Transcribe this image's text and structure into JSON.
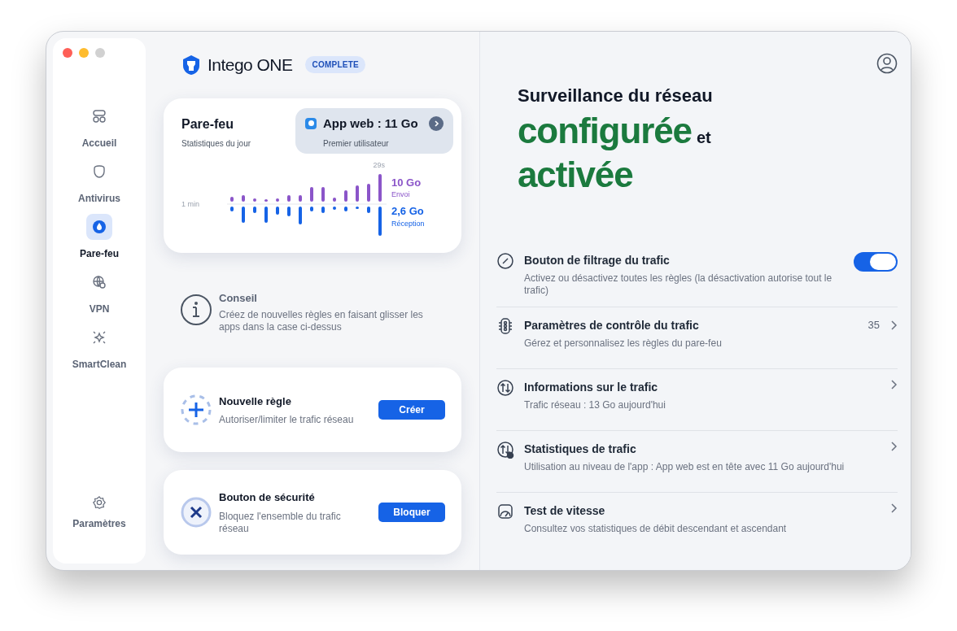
{
  "window": {
    "controls": [
      {
        "kind": "close"
      },
      {
        "kind": "minimize"
      },
      {
        "kind": "zoom"
      }
    ]
  },
  "sidebar": {
    "items": [
      {
        "label": "Accueil",
        "selected": false
      },
      {
        "label": "Antivirus",
        "selected": false
      },
      {
        "label": "Pare-feu",
        "selected": true
      },
      {
        "label": "VPN",
        "selected": false
      },
      {
        "label": "SmartClean",
        "selected": false
      }
    ],
    "footer": {
      "label": "Paramètres"
    }
  },
  "brand": {
    "name": "Intego ONE",
    "badge": "COMPLETE"
  },
  "firewall_card": {
    "title": "Pare-feu",
    "subtitle": "Statistiques du jour",
    "top_app": {
      "title": "App web : 11 Go",
      "subtitle": "Premier utilisateur"
    },
    "chart": {
      "time_start": "1 min",
      "time_end": "29s",
      "sent": {
        "value": "10 Go",
        "label": "Envoi"
      },
      "received": {
        "value": "2,6 Go",
        "label": "Réception"
      }
    }
  },
  "tip": {
    "title": "Conseil",
    "text": "Créez de nouvelles règles en faisant glisser les apps dans la case ci-dessus"
  },
  "action_cards": [
    {
      "title": "Nouvelle règle",
      "text": "Autoriser/limiter le trafic réseau",
      "button": "Créer"
    },
    {
      "title": "Bouton de sécurité",
      "text": "Bloquez l'ensemble du trafic réseau",
      "button": "Bloquer"
    }
  ],
  "headline": {
    "line1": "Surveillance du réseau",
    "parts": [
      {
        "text": "configurée",
        "kind": "highlight"
      },
      {
        "text": "et",
        "kind": "plain"
      },
      {
        "text": "activée",
        "kind": "highlight"
      }
    ]
  },
  "settings": [
    {
      "kind": "toggle",
      "title": "Bouton de filtrage du trafic",
      "text": "Activez ou désactivez toutes les règles (la désactivation autorise tout le trafic)",
      "on": true
    },
    {
      "kind": "link",
      "title": "Paramètres de contrôle du trafic",
      "text": "Gérez et personnalisez les règles du pare-feu",
      "count": "35"
    },
    {
      "kind": "link",
      "title": "Informations sur le trafic",
      "text": "Trafic réseau : 13 Go aujourd'hui"
    },
    {
      "kind": "link",
      "title": "Statistiques de trafic",
      "text": "Utilisation au niveau de l'app : App web est en tête avec 11 Go aujourd'hui"
    },
    {
      "kind": "link",
      "title": "Test de vitesse",
      "text": "Consultez vos statistiques de débit descendant et ascendant"
    }
  ]
}
